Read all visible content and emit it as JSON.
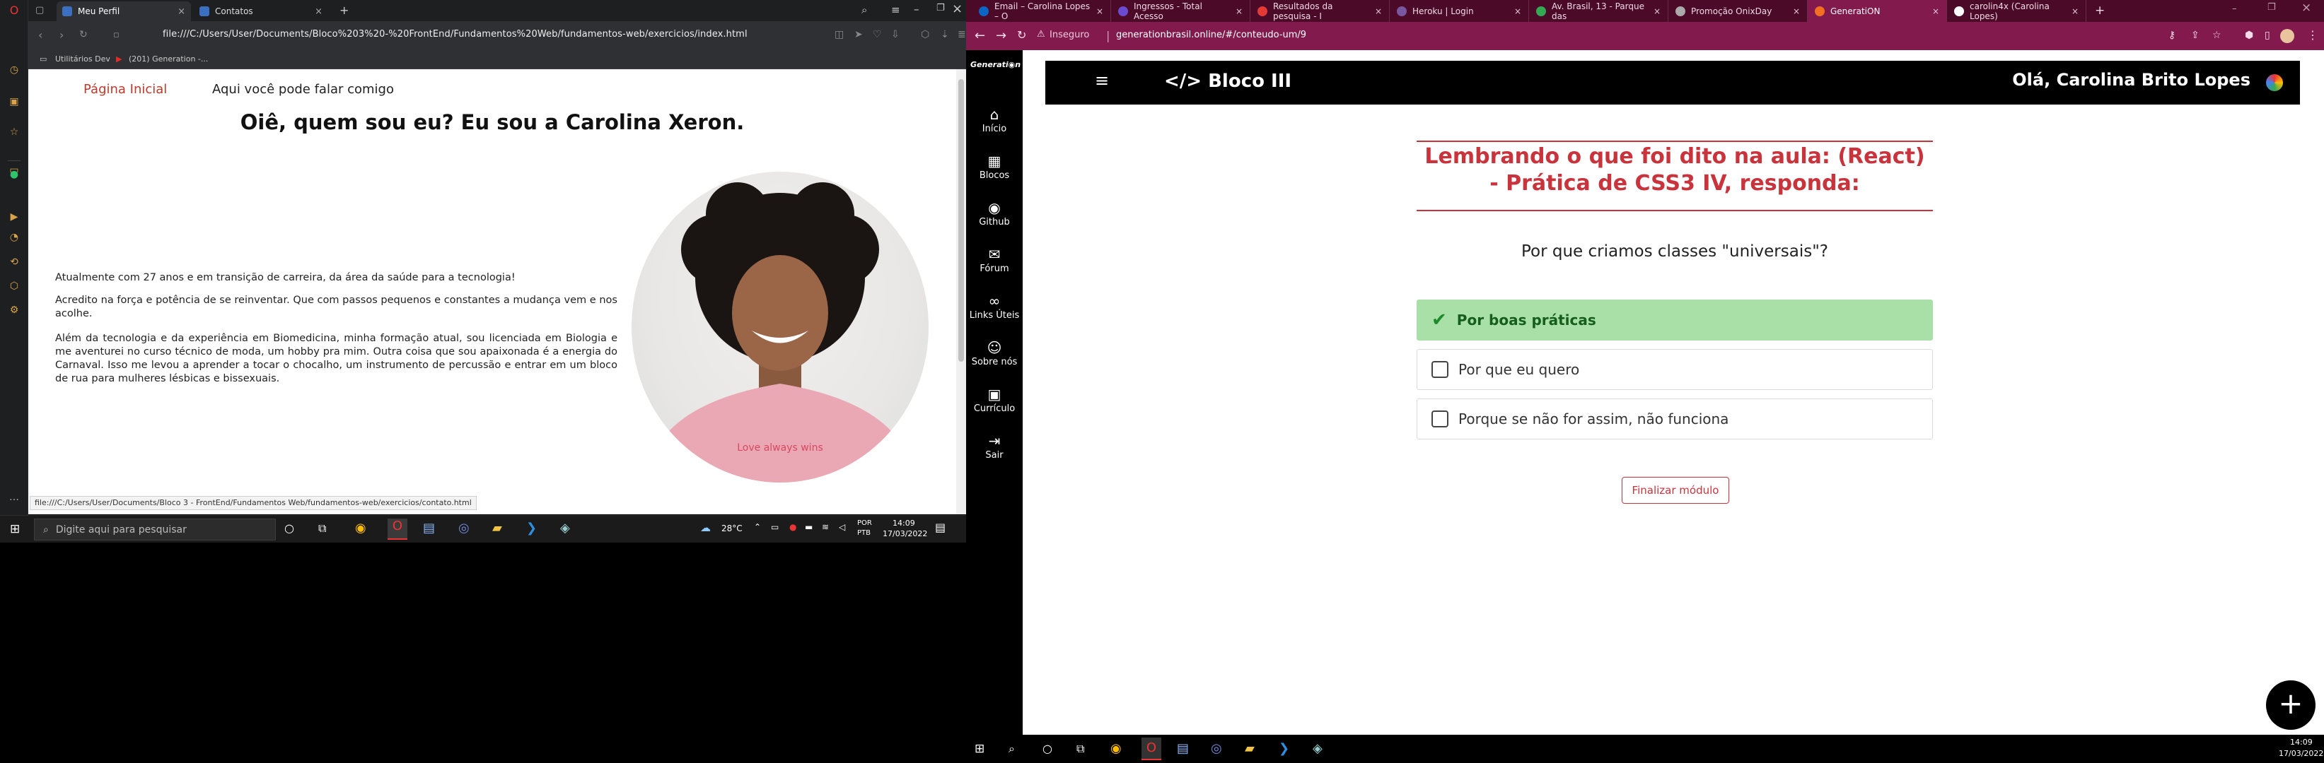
{
  "left_browser": {
    "tabs": [
      {
        "label": "Meu Perfil",
        "active": true
      },
      {
        "label": "Contatos",
        "active": false
      }
    ],
    "url": "file:///C:/Users/User/Documents/Bloco%203%20-%20FrontEnd/Fundamentos%20Web/fundamentos-web/exercicios/index.html",
    "bookmarks": [
      "Utilitários Dev",
      "(201) Generation -..."
    ],
    "status_url": "file:///C:/Users/User/Documents/Bloco 3 - FrontEnd/Fundamentos Web/fundamentos-web/exercicios/contato.html",
    "page": {
      "nav": {
        "home": "Página Inicial",
        "contact": "Aqui você pode falar comigo"
      },
      "title": "Oiê, quem sou eu? Eu sou a Carolina Xeron.",
      "paragraphs": [
        "Atualmente com 27 anos e em transição de carreira, da área da saúde para a tecnologia!",
        "Acredito na força e potência de se reinventar. Que com passos pequenos e constantes a mudança vem e nos acolhe.",
        "Além da tecnologia e da experiência em Biomedicina, minha formação atual, sou licenciada em Biologia e me aventurei no curso técnico de moda, um hobby pra mim. Outra coisa que sou apaixonada é a energia do Carnaval. Isso me levou a aprender a tocar o chocalho, um instrumento de percussão e entrar em um bloco de rua para mulheres lésbicas e bissexuais."
      ],
      "shirt_text": "Love always wins"
    }
  },
  "left_taskbar": {
    "search_placeholder": "Digite aqui para pesquisar",
    "weather": "28°C",
    "lang": "POR",
    "lang_sub": "PTB",
    "time": "14:09",
    "date": "17/03/2022"
  },
  "right_browser": {
    "tabs": [
      {
        "label": "Email – Carolina Lopes – O",
        "active": false
      },
      {
        "label": "Ingressos - Total Acesso",
        "active": false
      },
      {
        "label": "Resultados da pesquisa - I",
        "active": false
      },
      {
        "label": "Heroku | Login",
        "active": false
      },
      {
        "label": "Av. Brasil, 13 - Parque das",
        "active": false
      },
      {
        "label": "Promoção OnixDay",
        "active": false
      },
      {
        "label": "GeneratiON",
        "active": true
      },
      {
        "label": "carolin4x (Carolina Lopes)",
        "active": false
      }
    ],
    "insecure_label": "Inseguro",
    "url": "generationbrasil.online/#/conteudo-um/9",
    "sidebar": [
      {
        "label": "Início",
        "icon": "home-icon",
        "glyph": "⌂"
      },
      {
        "label": "Blocos",
        "icon": "grid-icon",
        "glyph": "▦"
      },
      {
        "label": "Github",
        "icon": "github-icon",
        "glyph": "◉"
      },
      {
        "label": "Fórum",
        "icon": "chat-icon",
        "glyph": "💬"
      },
      {
        "label": "Links Úteis",
        "icon": "link-icon",
        "glyph": "🔗"
      },
      {
        "label": "Sobre nós",
        "icon": "users-icon",
        "glyph": "👥"
      },
      {
        "label": "Currículo",
        "icon": "briefcase-icon",
        "glyph": "💼"
      },
      {
        "label": "Sair",
        "icon": "logout-icon",
        "glyph": "⇥"
      }
    ],
    "header": {
      "menu_glyph": "≡",
      "title": "</> Bloco III",
      "greeting": "Olá, Carolina Brito Lopes"
    },
    "quiz": {
      "heading": "Lembrando o que foi dito na aula: (React) - Prática de CSS3 IV, responda:",
      "question": "Por que criamos classes \"universais\"?",
      "options": [
        {
          "label": "Por boas práticas",
          "correct": true
        },
        {
          "label": "Por que eu quero",
          "correct": false
        },
        {
          "label": "Porque se não for assim, não funciona",
          "correct": false
        }
      ],
      "finish_button": "Finalizar módulo"
    },
    "fab": "+"
  },
  "right_taskbar": {
    "time": "14:09",
    "date": "17/03/2022"
  },
  "colors": {
    "quiz_red": "#c9343c",
    "correct_bg": "#a8e0a8",
    "chrome_theme": "#821a4d",
    "opera_dark": "#1e1f21"
  }
}
